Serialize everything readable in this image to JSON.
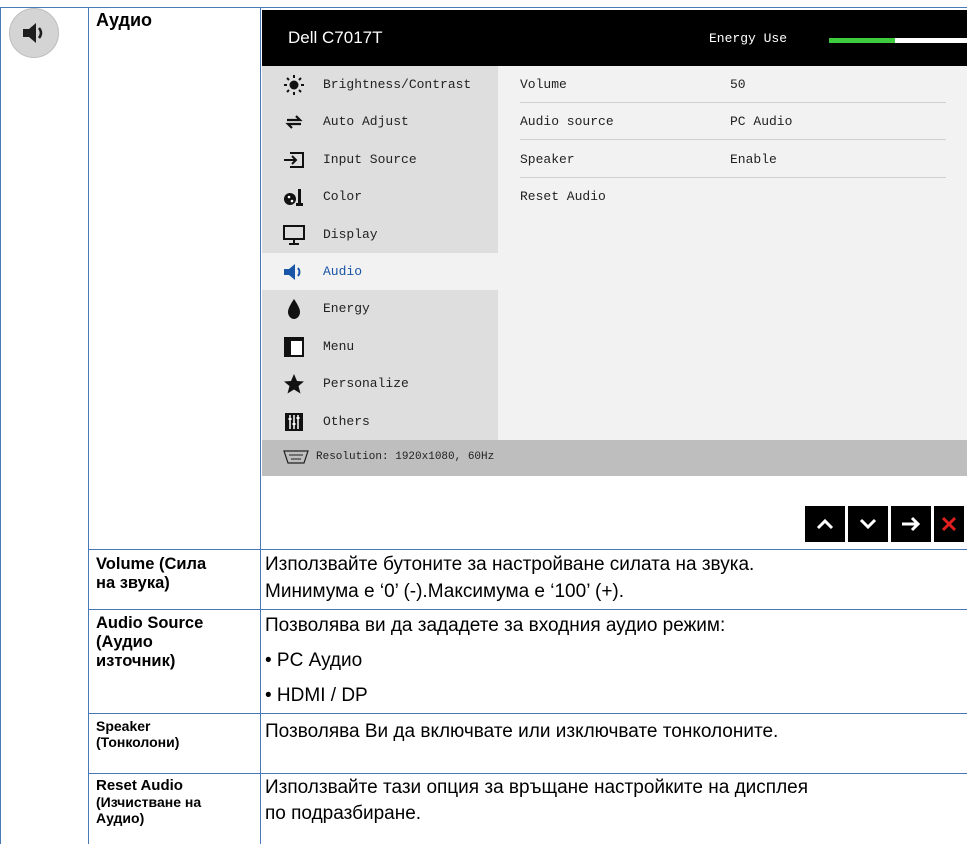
{
  "heading": "Аудио",
  "osd": {
    "model": "Dell C7017T",
    "energy_label": "Energy Use",
    "energy_level": 0.48,
    "menu": [
      {
        "label": "Brightness/Contrast",
        "icon": "brightness-icon"
      },
      {
        "label": "Auto Adjust",
        "icon": "auto-adjust-icon"
      },
      {
        "label": "Input Source",
        "icon": "input-source-icon"
      },
      {
        "label": "Color",
        "icon": "color-icon"
      },
      {
        "label": "Display",
        "icon": "display-icon"
      },
      {
        "label": "Audio",
        "icon": "speaker-icon",
        "active": true
      },
      {
        "label": "Energy",
        "icon": "energy-icon"
      },
      {
        "label": "Menu",
        "icon": "menu-icon"
      },
      {
        "label": "Personalize",
        "icon": "star-icon"
      },
      {
        "label": "Others",
        "icon": "others-icon"
      }
    ],
    "options": [
      {
        "name": "Volume",
        "value": "50"
      },
      {
        "name": "Audio source",
        "value": "PC Audio"
      },
      {
        "name": "Speaker",
        "value": "Enable"
      },
      {
        "name": "Reset Audio",
        "value": ""
      }
    ],
    "resolution": "Resolution: 1920x1080, 60Hz",
    "nav_buttons": [
      "up-arrow-icon",
      "down-arrow-icon",
      "right-arrow-icon",
      "close-icon"
    ],
    "accent_colors": {
      "active_item": "#1a56a8",
      "energy_fill": "#3ecb3e",
      "close": "#e02020"
    }
  },
  "rows": [
    {
      "term_lines": [
        "Volume (Сила",
        "на звука)"
      ],
      "desc_lines": [
        "Използвайте бутоните за настройване силата на звука.",
        "Минимума е ‘0’ (-).Максимума е ‘100’ (+)."
      ]
    },
    {
      "term_lines": [
        "Audio Source",
        "(Аудио",
        "източник)"
      ],
      "desc_lines": [
        "Позволява ви да зададете за входния аудио режим:",
        "• PC Аудио",
        "• HDMI / DP"
      ]
    },
    {
      "term_lines": [
        "Speaker",
        "(Тонколони)"
      ],
      "desc_lines": [
        "Позволява Ви да включвате или изключвате тонколоните."
      ]
    },
    {
      "term_lines": [
        "Reset Audio",
        "(Изчистване на",
        "Аудио)"
      ],
      "desc_lines": [
        "Използвайте тази опция за връщане настройките на дисплея",
        "по подразбиране."
      ]
    }
  ]
}
